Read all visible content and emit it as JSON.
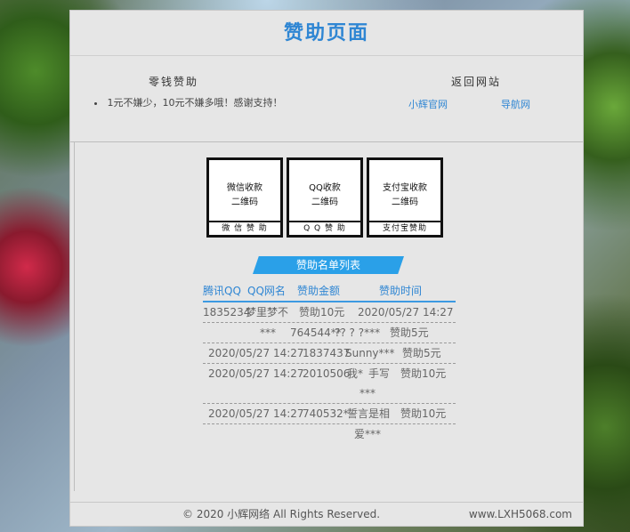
{
  "header": {
    "title": "赞助页面"
  },
  "left_section": {
    "heading": "零钱赞助",
    "bullet": "1元不嫌少，10元不嫌多哦！感谢支持！"
  },
  "right_section": {
    "heading": "返回网站",
    "links": [
      "小辉官网",
      "导航网"
    ]
  },
  "qr_codes": [
    {
      "text_line1": "微信收款",
      "text_line2": "二维码",
      "label": "微 信 赞 助"
    },
    {
      "text_line1": "QQ收款",
      "text_line2": "二维码",
      "label": "Q Q 赞 助"
    },
    {
      "text_line1": "支付宝收款",
      "text_line2": "二维码",
      "label": "支付宝赞助"
    }
  ],
  "sponsor_list": {
    "title": "赞助名单列表",
    "columns": [
      "腾讯QQ",
      "QQ网名",
      "赞助金额",
      "赞助时间"
    ],
    "rows": [
      {
        "cells": [
          "1835234",
          "梦里梦不",
          "赞助10元",
          "2020/05/27 14:27"
        ],
        "extra": ""
      },
      {
        "cells": [
          "***",
          "764544**",
          "?? ? ?***",
          "赞助5元"
        ],
        "extra": ""
      },
      {
        "cells": [
          "2020/05/27 14:27",
          "1837437",
          "Sunny***",
          "赞助5元"
        ],
        "extra": ""
      },
      {
        "cells": [
          "2020/05/27 14:27",
          "2010506",
          "我*",
          "手写",
          "赞助10元"
        ],
        "extra": "***"
      },
      {
        "cells": [
          "2020/05/27 14:27",
          "740532*",
          "誓言是相",
          "赞助10元"
        ],
        "extra": "爱***"
      }
    ]
  },
  "footer": {
    "copyright": "© 2020 小辉网络 All Rights Reserved.",
    "site": "www.LXH5068.com"
  }
}
